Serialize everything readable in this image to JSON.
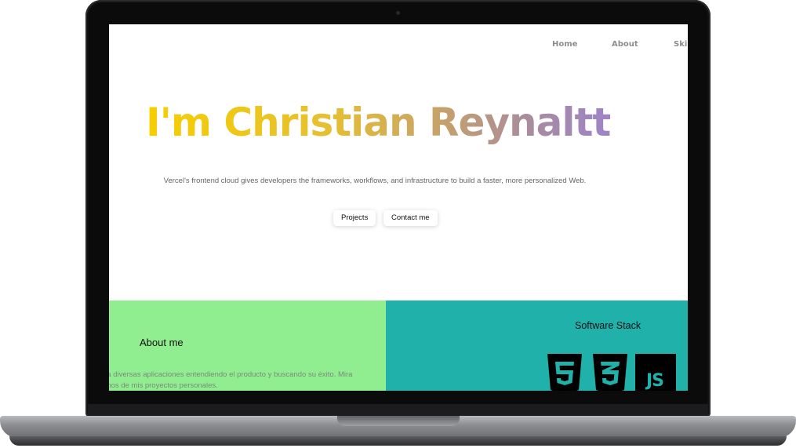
{
  "nav": {
    "items": [
      {
        "label": "Home"
      },
      {
        "label": "About"
      },
      {
        "label": "Skill"
      }
    ]
  },
  "hero": {
    "title": "I'm Christian Reynaltt",
    "subtitle": "Vercel's frontend cloud gives developers the frameworks, workflows, and infrastructure to build a faster, more personalized Web.",
    "buttons": {
      "projects": "Projects",
      "contact": "Contact me"
    },
    "gradient": [
      "#f6cf00",
      "#9e84c7"
    ]
  },
  "about": {
    "title": "About me",
    "text": "ea diversas aplicaciones entendiendo el producto y buscando su éxito. Mira\nunos de mis proyectos personales.",
    "background": "#90ee90"
  },
  "stack": {
    "title": "Software Stack",
    "background": "#20b2aa",
    "logos": [
      {
        "icon": "html5-icon",
        "label": "5"
      },
      {
        "icon": "css3-icon",
        "label": "3"
      },
      {
        "icon": "javascript-icon",
        "label": "JS"
      }
    ]
  }
}
